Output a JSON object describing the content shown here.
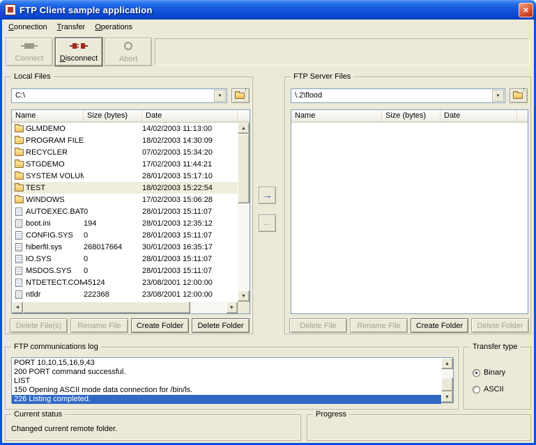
{
  "window": {
    "title": "FTP Client sample application"
  },
  "menu": {
    "items": [
      "Connection",
      "Transfer",
      "Operations"
    ]
  },
  "toolbar": {
    "buttons": [
      {
        "label": "Connect",
        "icon": "plug-connect-icon",
        "enabled": false
      },
      {
        "label": "Disconnect",
        "icon": "plug-disconnect-icon",
        "enabled": true
      },
      {
        "label": "Abort",
        "icon": "abort-circle-icon",
        "enabled": false
      }
    ]
  },
  "local": {
    "group_title": "Local Files",
    "path": "C:\\",
    "columns": [
      "Name",
      "Size (bytes)",
      "Date"
    ],
    "rows": [
      {
        "name": "GLMDEMO",
        "type": "folder",
        "size": "",
        "date": "14/02/2003 11:13:00"
      },
      {
        "name": "PROGRAM FILES",
        "type": "folder",
        "size": "",
        "date": "18/02/2003 14:30:09"
      },
      {
        "name": "RECYCLER",
        "type": "folder",
        "size": "",
        "date": "07/02/2003 15:34:20"
      },
      {
        "name": "STGDEMO",
        "type": "folder",
        "size": "",
        "date": "17/02/2003 11:44:21"
      },
      {
        "name": "SYSTEM VOLUME ...",
        "type": "folder",
        "size": "",
        "date": "28/01/2003 15:17:10"
      },
      {
        "name": "TEST",
        "type": "folder",
        "size": "",
        "date": "18/02/2003 15:22:54",
        "selected": true
      },
      {
        "name": "WINDOWS",
        "type": "folder",
        "size": "",
        "date": "17/02/2003 15:06:28"
      },
      {
        "name": "AUTOEXEC.BAT",
        "type": "file",
        "size": "0",
        "date": "28/01/2003 15:11:07"
      },
      {
        "name": "boot.ini",
        "type": "file",
        "size": "194",
        "date": "28/01/2003 12:35:12"
      },
      {
        "name": "CONFIG.SYS",
        "type": "file",
        "size": "0",
        "date": "28/01/2003 15:11:07"
      },
      {
        "name": "hiberfil.sys",
        "type": "file",
        "size": "268017664",
        "date": "30/01/2003 16:35:17"
      },
      {
        "name": "IO.SYS",
        "type": "file",
        "size": "0",
        "date": "28/01/2003 15:11:07"
      },
      {
        "name": "MSDOS.SYS",
        "type": "file",
        "size": "0",
        "date": "28/01/2003 15:11:07"
      },
      {
        "name": "NTDETECT.COM",
        "type": "file",
        "size": "45124",
        "date": "23/08/2001 12:00:00"
      },
      {
        "name": "ntldr",
        "type": "file",
        "size": "222368",
        "date": "23/08/2001 12:00:00"
      }
    ],
    "buttons": [
      {
        "label": "Delete File(s)",
        "enabled": false
      },
      {
        "label": "Rename File",
        "enabled": false
      },
      {
        "label": "Create Folder",
        "enabled": true
      },
      {
        "label": "Delete Folder",
        "enabled": true
      }
    ]
  },
  "server": {
    "group_title": "FTP Server Files",
    "path": "\\.2\\flood",
    "columns": [
      "Name",
      "Size (bytes)",
      "Date"
    ],
    "rows": [],
    "buttons": [
      {
        "label": "Delete File",
        "enabled": false
      },
      {
        "label": "Rename File",
        "enabled": false
      },
      {
        "label": "Create Folder",
        "enabled": true
      },
      {
        "label": "Delete Folder",
        "enabled": false
      }
    ]
  },
  "log": {
    "group_title": "FTP communications log",
    "lines": [
      "PORT 10,10,15,16,9,43",
      "200 PORT command successful.",
      "LIST",
      "150 Opening ASCII mode data connection for /bin/ls.",
      "226 Listing completed."
    ],
    "selected_index": 4
  },
  "transfer_type": {
    "group_title": "Transfer type",
    "options": [
      "Binary",
      "ASCII"
    ],
    "selected": "Binary"
  },
  "status": {
    "group_title": "Current status",
    "text": "Changed current remote folder."
  },
  "progress": {
    "group_title": "Progress"
  },
  "colors": {
    "window_bg": "#ECE9D8",
    "titlebar_blue": "#0853DD",
    "selection_blue": "#316AC5",
    "disabled_text": "#A5A294",
    "disconnect_red": "#9C2A21"
  }
}
